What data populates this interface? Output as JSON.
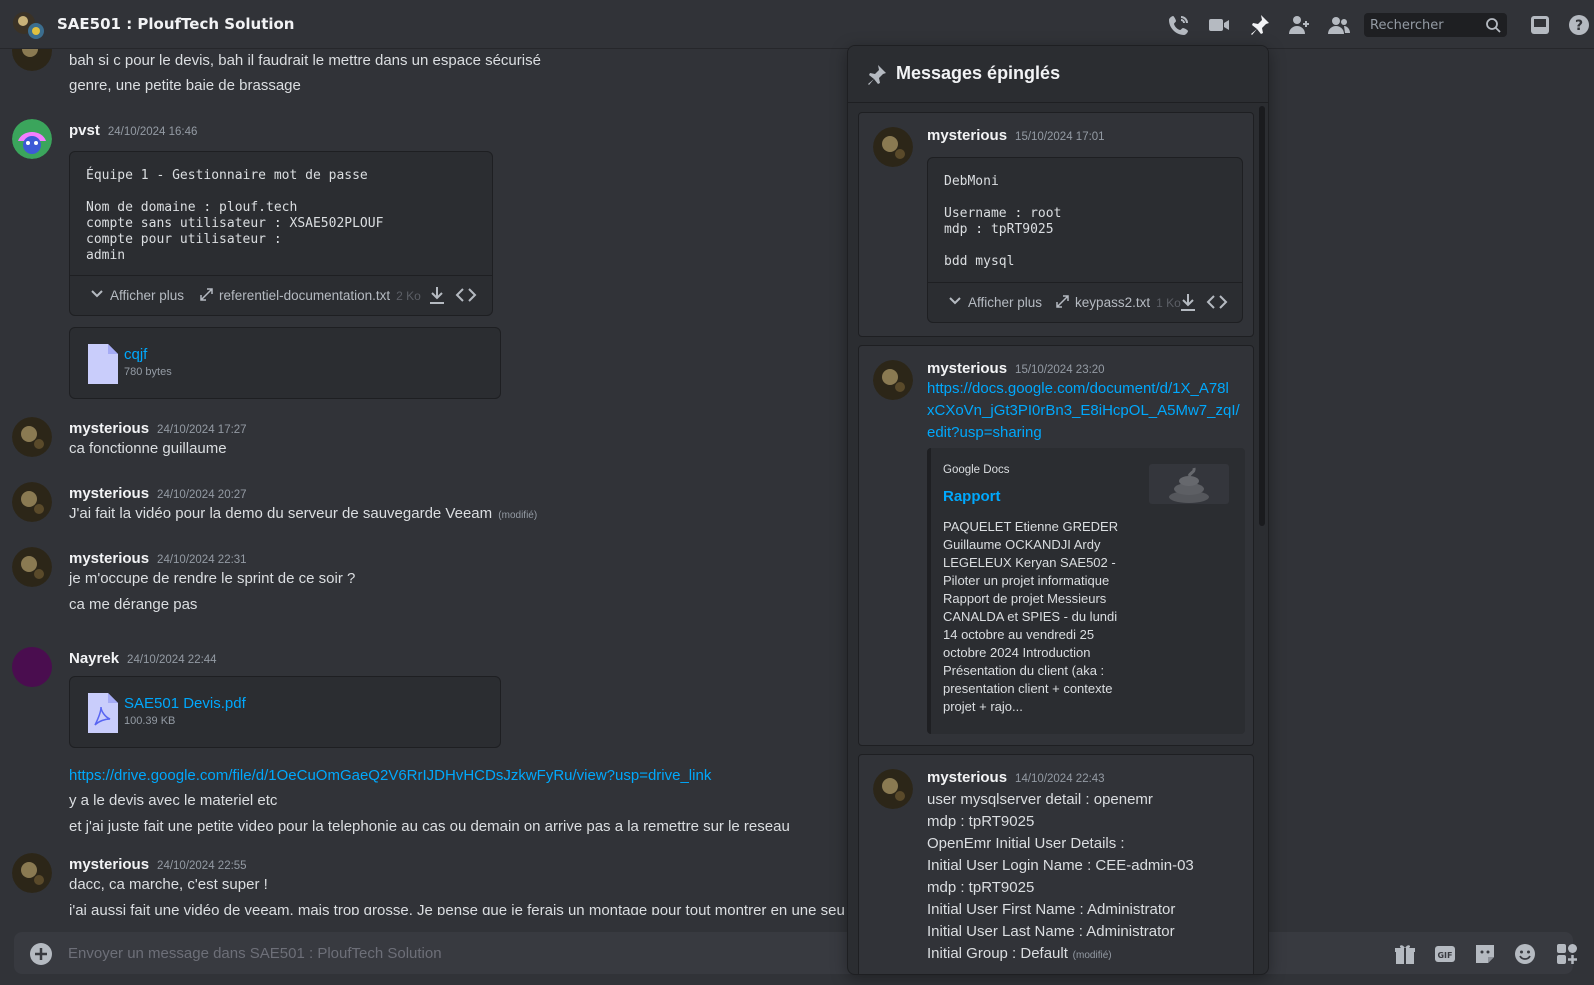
{
  "header": {
    "title": "SAE501 : PloufTech Solution",
    "search_placeholder": "Rechercher"
  },
  "messages": {
    "m0": {
      "line1": "bah si c pour le devis, bah il faudrait le mettre dans un espace sécurisé",
      "line2": "genre, une petite baie de brassage"
    },
    "m1": {
      "author": "pvst",
      "timestamp": "24/10/2024 16:46",
      "code": "Équipe 1 - Gestionnaire mot de passe\n\nNom de domaine : plouf.tech\ncompte sans utilisateur : XSAE502PLOUF\ncompte pour utilisateur :\nadmin",
      "show_more": "Afficher plus",
      "file_name": "referentiel-documentation.txt",
      "file_size": "2 Ko",
      "attachment_name": "cqjf",
      "attachment_size": "780 bytes"
    },
    "m2": {
      "author": "mysterious",
      "timestamp": "24/10/2024 17:27",
      "line1": "ca fonctionne guillaume"
    },
    "m3": {
      "author": "mysterious",
      "timestamp": "24/10/2024 20:27",
      "line1": "J'ai fait la vidéo pour la demo du serveur de sauvegarde Veeam",
      "edited": "(modifié)"
    },
    "m4": {
      "author": "mysterious",
      "timestamp": "24/10/2024 22:31",
      "line1": "je m'occupe de rendre le sprint de ce soir ?",
      "line2": "ca me dérange pas"
    },
    "m5": {
      "author": "Nayrek",
      "timestamp": "24/10/2024 22:44",
      "attachment_name": "SAE501 Devis.pdf",
      "attachment_size": "100.39 KB",
      "link": "https://drive.google.com/file/d/1OeCuOmGaeQ2V6RrIJDHvHCDsJzkwFyRu/view?usp=drive_link",
      "line1": "y a le devis avec le materiel etc",
      "line2": "et j'ai juste fait une petite video pour la telephonie au cas ou demain on arrive pas a la remettre sur le reseau"
    },
    "m6": {
      "author": "mysterious",
      "timestamp": "24/10/2024 22:55",
      "line1": "dacc, ca marche, c'est super !",
      "line2": "j'ai aussi fait une vidéo de veeam, mais trop grosse. Je pense que je ferais un montage pour tout montrer en une seu"
    }
  },
  "composer": {
    "placeholder": "Envoyer un message dans SAE501 : PloufTech Solution"
  },
  "pins": {
    "title": "Messages épinglés",
    "p1": {
      "author": "mysterious",
      "timestamp": "15/10/2024 17:01",
      "code": "DebMoni\n\nUsername : root\nmdp : tpRT9025\n\nbdd mysql",
      "show_more": "Afficher plus",
      "file_name": "keypass2.txt",
      "file_size": "1 Ko"
    },
    "p2": {
      "author": "mysterious",
      "timestamp": "15/10/2024 23:20",
      "link1": "https://docs.google.com/document/d/1X_A78l",
      "link2": "xCXoVn_jGt3PI0rBn3_E8iHcpOL_A5Mw7_zqI/",
      "link3": "edit?usp=sharing",
      "embed_provider": "Google Docs",
      "embed_title": "Rapport",
      "embed_desc": [
        "PAQUELET Etienne GREDER",
        "Guillaume OCKANDJI Ardy",
        "LEGELEUX Keryan SAE502 -",
        "Piloter un projet informatique",
        "Rapport de projet Messieurs",
        "CANALDA et SPIES - du lundi",
        "14 octobre au vendredi 25",
        "octobre 2024 Introduction",
        "Présentation du client (aka :",
        "presentation client + contexte",
        "projet + rajo..."
      ]
    },
    "p3": {
      "author": "mysterious",
      "timestamp": "14/10/2024 22:43",
      "lines": [
        "user mysqlserver detail : openemr",
        "mdp : tpRT9025",
        "OpenEmr Initial User Details :",
        "Initial User Login Name : CEE-admin-03",
        "mdp : tpRT9025",
        "Initial User First Name : Administrator",
        "Initial User Last Name : Administrator",
        "Initial Group : Default"
      ],
      "edited": "(modifié)"
    }
  }
}
